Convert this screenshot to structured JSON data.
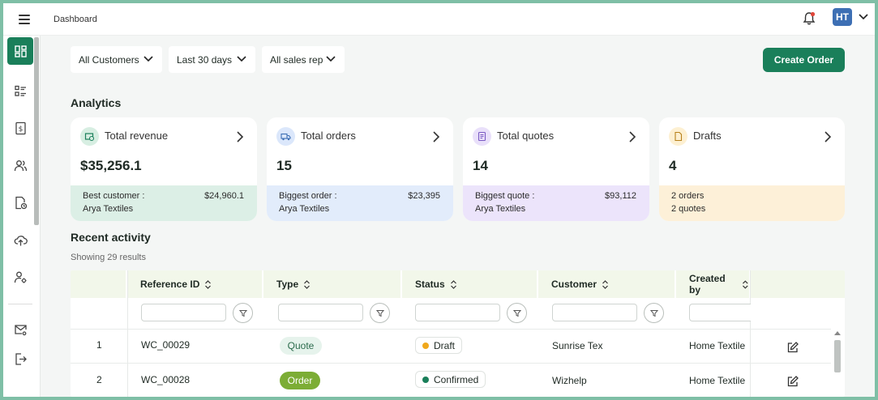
{
  "header": {
    "breadcrumb": "Dashboard",
    "avatar_initials": "HT"
  },
  "sidebar": {
    "items": [
      {
        "icon": "dashboard-icon",
        "active": true
      },
      {
        "icon": "list-icon"
      },
      {
        "icon": "invoice-icon"
      },
      {
        "icon": "users-icon"
      },
      {
        "icon": "file-clock-icon"
      },
      {
        "icon": "upload-cloud-icon"
      },
      {
        "icon": "user-settings-icon"
      },
      {
        "icon": "mail-settings-icon"
      },
      {
        "icon": "logout-icon"
      }
    ]
  },
  "filters": {
    "customers": "All Customers",
    "period": "Last 30 days",
    "sales_rep": "All sales rep"
  },
  "create_order_label": "Create Order",
  "analytics": {
    "title": "Analytics",
    "cards": [
      {
        "label": "Total revenue",
        "value": "$35,256.1",
        "footer_l1": "Best customer :",
        "footer_amount": "$24,960.1",
        "footer_l2": "Arya Textiles",
        "color": "#dcefe6",
        "icon_bg": "#d7eee2"
      },
      {
        "label": "Total orders",
        "value": "15",
        "footer_l1": "Biggest order :",
        "footer_amount": "$23,395",
        "footer_l2": "Arya Textiles",
        "color": "#e2ecfb",
        "icon_bg": "#dbe7fb"
      },
      {
        "label": "Total quotes",
        "value": "14",
        "footer_l1": "Biggest quote :",
        "footer_amount": "$93,112",
        "footer_l2": "Arya Textiles",
        "color": "#ece4fb",
        "icon_bg": "#e9e0fa"
      },
      {
        "label": "Drafts",
        "value": "4",
        "footer_l1": "2 orders",
        "footer_amount": "",
        "footer_l2": "2 quotes",
        "color": "#fdf0d8",
        "icon_bg": "#fdf0d2"
      }
    ]
  },
  "recent": {
    "title": "Recent activity",
    "results": "Showing 29 results",
    "columns": [
      "Reference ID",
      "Type",
      "Status",
      "Customer",
      "Created by"
    ],
    "rows": [
      {
        "num": "1",
        "ref": "WC_00029",
        "type": "Quote",
        "status": "Draft",
        "status_color": "#f0a81c",
        "customer": "Sunrise Tex",
        "created_by": "Home Textile"
      },
      {
        "num": "2",
        "ref": "WC_00028",
        "type": "Order",
        "status": "Confirmed",
        "status_color": "#1a7f5a",
        "customer": "Wizhelp",
        "created_by": "Home Textile"
      }
    ]
  }
}
